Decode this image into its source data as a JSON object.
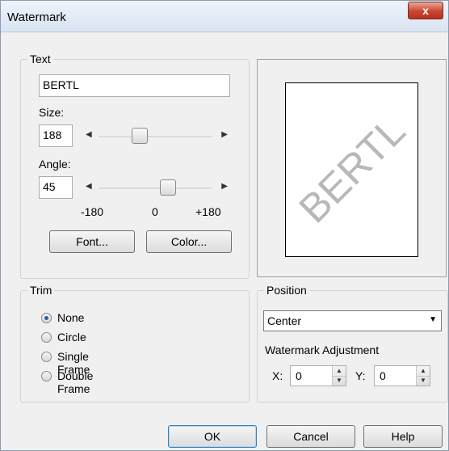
{
  "window": {
    "title": "Watermark",
    "close_glyph": "x"
  },
  "text_group": {
    "label": "Text",
    "text_value": "BERTL",
    "size_label": "Size:",
    "size_value": "188",
    "angle_label": "Angle:",
    "angle_value": "45",
    "angle_scale": [
      "-180",
      "0",
      "+180"
    ],
    "font_button": "Font...",
    "color_button": "Color..."
  },
  "preview": {
    "watermark_text": "BERTL"
  },
  "trim_group": {
    "label": "Trim",
    "options": [
      {
        "label": "None",
        "checked": true
      },
      {
        "label": "Circle",
        "checked": false
      },
      {
        "label": "Single Frame",
        "checked": false
      },
      {
        "label": "Double Frame",
        "checked": false
      }
    ]
  },
  "position_group": {
    "label": "Position",
    "selected": "Center",
    "adjustment_label": "Watermark Adjustment",
    "x_label": "X:",
    "x_value": "0",
    "y_label": "Y:",
    "y_value": "0"
  },
  "buttons": {
    "ok": "OK",
    "cancel": "Cancel",
    "help": "Help"
  }
}
